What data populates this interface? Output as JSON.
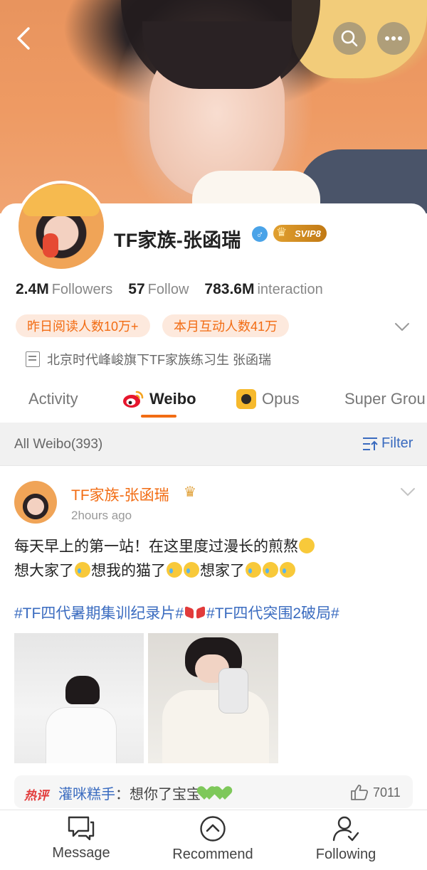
{
  "profile": {
    "name": "TF家族-张函瑞",
    "gender_icon": "male-icon",
    "vip_badge": "SVIP8",
    "stats": [
      {
        "value": "2.4M",
        "label": "Followers"
      },
      {
        "value": "57",
        "label": "Follow"
      },
      {
        "value": "783.6M",
        "label": "interaction"
      }
    ],
    "tags": [
      "昨日阅读人数10万+",
      "本月互动人数41万"
    ],
    "bio": "北京时代峰峻旗下TF家族练习生 张函瑞"
  },
  "tabs": [
    {
      "label": "Activity",
      "icon": null,
      "active": false
    },
    {
      "label": "Weibo",
      "icon": "weibo-logo-icon",
      "active": true
    },
    {
      "label": "Opus",
      "icon": "opus-icon",
      "active": false
    },
    {
      "label": "Super Grou",
      "icon": null,
      "active": false
    }
  ],
  "feed_header": {
    "all_label": "All Weibo(393)",
    "filter_label": "Filter"
  },
  "post": {
    "author": "TF家族-张函瑞",
    "time": "2hours ago",
    "line1": "每天早上的第一站！在这里度过漫长的煎熬",
    "line2a": "想大家了",
    "line2b": "想我的猫了",
    "line2c": "想家了",
    "tag1": "#TF四代暑期集训纪录片#",
    "tag2": "#TF四代突围2破局#",
    "images": [
      "photo-1",
      "photo-2"
    ]
  },
  "hot_comment": {
    "badge": "热评",
    "user": "灌咪糕手",
    "separator": "：",
    "text": "想你了宝宝",
    "likes": "7011"
  },
  "bottom_nav": [
    {
      "label": "Message",
      "icon": "message-icon"
    },
    {
      "label": "Recommend",
      "icon": "recommend-icon"
    },
    {
      "label": "Following",
      "icon": "following-icon"
    }
  ],
  "colors": {
    "accent": "#f26c13",
    "link": "#3b6cc0",
    "tag_bg": "#fde9dd"
  }
}
